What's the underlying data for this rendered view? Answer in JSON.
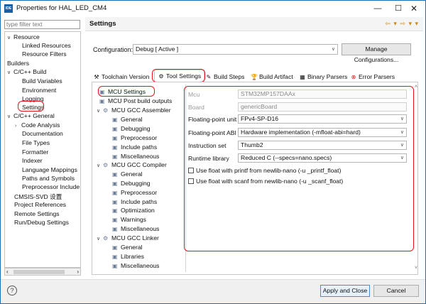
{
  "window": {
    "title": "Properties for HAL_LED_CM4",
    "app_icon_text": "IDE",
    "minimize": "—",
    "maximize": "☐",
    "close": "✕"
  },
  "filter": {
    "placeholder": "type filter text"
  },
  "tree": [
    {
      "label": "Resource",
      "arrow": "∨"
    },
    {
      "label": "Linked Resources"
    },
    {
      "label": "Resource Filters"
    },
    {
      "label": "Builders"
    },
    {
      "label": "C/C++ Build",
      "arrow": "∨"
    },
    {
      "label": "Build Variables"
    },
    {
      "label": "Environment"
    },
    {
      "label": "Logging"
    },
    {
      "label": "Settings"
    },
    {
      "label": "C/C++ General",
      "arrow": "∨"
    },
    {
      "label": "Code Analysis",
      "arrow": "›"
    },
    {
      "label": "Documentation"
    },
    {
      "label": "File Types"
    },
    {
      "label": "Formatter"
    },
    {
      "label": "Indexer"
    },
    {
      "label": "Language Mappings"
    },
    {
      "label": "Paths and Symbols"
    },
    {
      "label": "Preprocessor Include"
    },
    {
      "label": "CMSIS-SVD 设置"
    },
    {
      "label": "Project References"
    },
    {
      "label": "Remote Settings"
    },
    {
      "label": "Run/Debug Settings"
    }
  ],
  "scroll": {
    "left": "‹",
    "right": "›",
    "up": "˄",
    "down": "˅"
  },
  "settings": {
    "title": "Settings",
    "nav": "⇦ ▾ ⇨ ▾ ▾"
  },
  "configuration": {
    "label": "Configuration:",
    "value": "Debug  [ Active ]",
    "manage_button": "Manage Configurations..."
  },
  "tabs": [
    {
      "label": "Toolchain Version",
      "icon": "⚒"
    },
    {
      "label": "Tool Settings",
      "icon": "⚙"
    },
    {
      "label": "Build Steps",
      "icon": "✎"
    },
    {
      "label": "Build Artifact",
      "icon": "🏆"
    },
    {
      "label": "Binary Parsers",
      "icon": "▦"
    },
    {
      "label": "Error Parsers",
      "icon": "⊗"
    }
  ],
  "tool_tree": [
    {
      "label": "MCU Settings",
      "icon": "▣"
    },
    {
      "label": "MCU Post build outputs",
      "icon": "▣"
    },
    {
      "label": "MCU GCC Assembler",
      "icon": "⚙",
      "arrow": "∨"
    },
    {
      "label": "General",
      "icon": "▣"
    },
    {
      "label": "Debugging",
      "icon": "▣"
    },
    {
      "label": "Preprocessor",
      "icon": "▣"
    },
    {
      "label": "Include paths",
      "icon": "▣"
    },
    {
      "label": "Miscellaneous",
      "icon": "▣"
    },
    {
      "label": "MCU GCC Compiler",
      "icon": "⚙",
      "arrow": "∨"
    },
    {
      "label": "General",
      "icon": "▣"
    },
    {
      "label": "Debugging",
      "icon": "▣"
    },
    {
      "label": "Preprocessor",
      "icon": "▣"
    },
    {
      "label": "Include paths",
      "icon": "▣"
    },
    {
      "label": "Optimization",
      "icon": "▣"
    },
    {
      "label": "Warnings",
      "icon": "▣"
    },
    {
      "label": "Miscellaneous",
      "icon": "▣"
    },
    {
      "label": "MCU GCC Linker",
      "icon": "⚙",
      "arrow": "∨"
    },
    {
      "label": "General",
      "icon": "▣"
    },
    {
      "label": "Libraries",
      "icon": "▣"
    },
    {
      "label": "Miscellaneous",
      "icon": "▣"
    }
  ],
  "fields": {
    "mcu": {
      "label": "Mcu",
      "value": "STM32MP157DAAx"
    },
    "board": {
      "label": "Board",
      "value": "genericBoard"
    },
    "fpu": {
      "label": "Floating-point unit",
      "value": "FPv4-SP-D16"
    },
    "abi": {
      "label": "Floating-point ABI",
      "value": "Hardware implementation (-mfloat-abi=hard)"
    },
    "iset": {
      "label": "Instruction set",
      "value": "Thumb2"
    },
    "runtime": {
      "label": "Runtime library",
      "value": "Reduced C (--specs=nano.specs)"
    }
  },
  "checks": {
    "printf": "Use float with printf from newlib-nano (-u _printf_float)",
    "scanf": "Use float with scanf from newlib-nano (-u _scanf_float)"
  },
  "buttons": {
    "help": "?",
    "apply": "Apply and Close",
    "cancel": "Cancel"
  },
  "dropdown_glyph": "∨",
  "colors": {
    "highlight": "#e2161c",
    "accent": "#1c6fb5"
  }
}
